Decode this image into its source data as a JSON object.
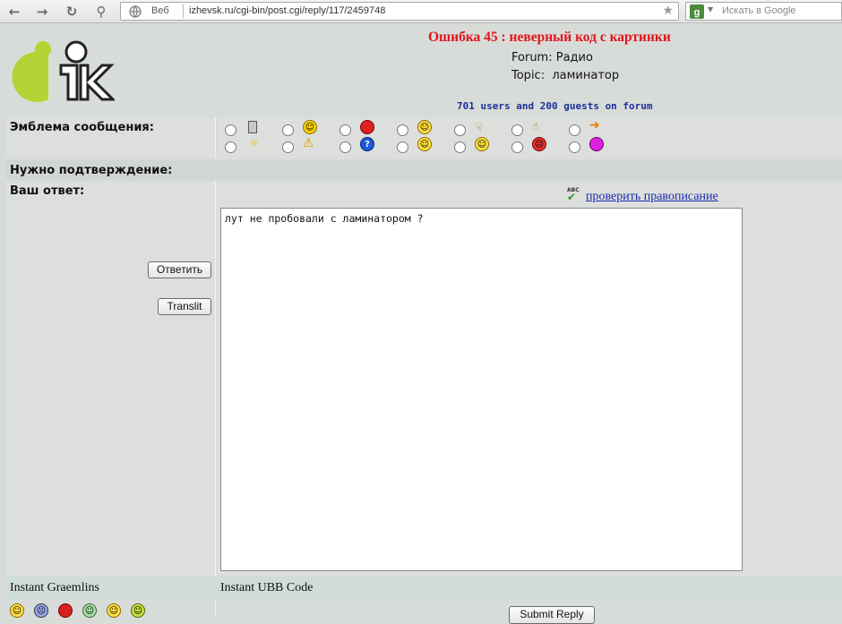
{
  "browser": {
    "web_label": "Веб",
    "url": "izhevsk.ru/cgi-bin/post.cgi/reply/117/2459748",
    "search_placeholder": "Искать в Google"
  },
  "header": {
    "error_title": "Ошибка 45 : неверный код с картинки",
    "forum_label": "Forum:",
    "forum_value": "Радио",
    "topic_label": "Topic:",
    "topic_value": "ламинатор",
    "users_line": "701 users and 200 guests on forum"
  },
  "form": {
    "emblem_label": "Эмблема сообщения:",
    "confirm_label": "Нужно подтверждение:",
    "answer_label": "Ваш ответ:",
    "reply_button": "Ответить",
    "translit_button": "Translit",
    "spellcheck_link": "проверить правописание",
    "spellcheck_icon": "ABC",
    "message_text": "лут не пробовали с ламинатором ?",
    "emblems_row1": [
      "document-icon",
      "laughing-icon",
      "stop-icon",
      "smile-icon",
      "thumbs-down-icon",
      "thumbs-up-icon",
      "arrow-icon"
    ],
    "emblems_row2": [
      "lightbulb-icon",
      "warning-icon",
      "question-icon",
      "cool-icon",
      "grin-icon",
      "sad-icon",
      "circle-icon"
    ]
  },
  "bottom": {
    "instant_graemlins": "Instant Graemlins",
    "instant_ubb": "Instant UBB Code",
    "submit_button": "Submit Reply"
  },
  "colors": {
    "error": "#e2141a",
    "users_line": "#1b2f9c",
    "link": "#1a2ab0",
    "logo_green": "#b5d334"
  }
}
